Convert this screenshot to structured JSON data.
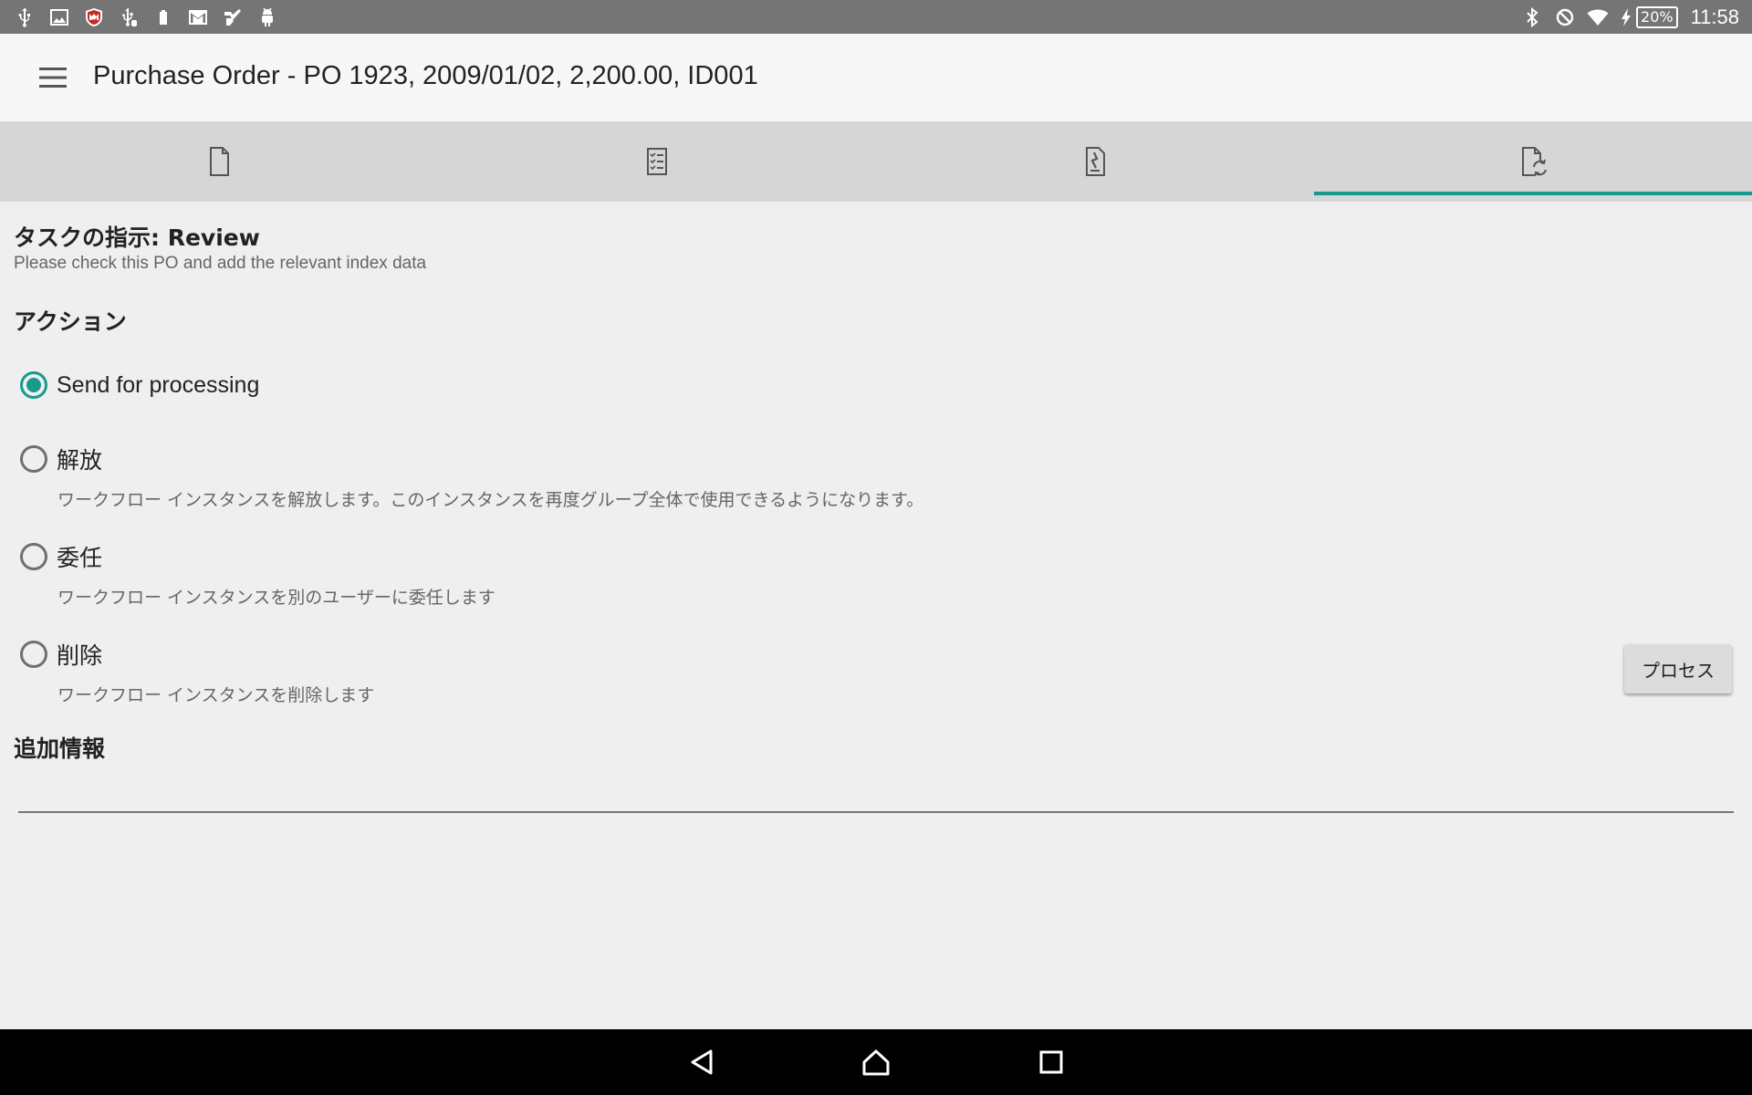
{
  "status_bar": {
    "left_icons": [
      "usb-icon",
      "image-icon",
      "mcafee-shield-icon",
      "usb-debug-icon",
      "battery-saver-icon",
      "gmail-icon",
      "play-store-icon",
      "android-debug-icon"
    ],
    "right_icons": [
      "bluetooth-icon",
      "do-not-disturb-icon",
      "wifi-icon",
      "charging-icon"
    ],
    "battery": "20%",
    "time": "11:58"
  },
  "app_bar": {
    "title": "Purchase Order - PO 1923, 2009/01/02, 2,200.00, ID001"
  },
  "tabs": [
    {
      "icon": "document-icon",
      "active": false
    },
    {
      "icon": "checklist-icon",
      "active": false
    },
    {
      "icon": "signature-document-icon",
      "active": false
    },
    {
      "icon": "workflow-document-icon",
      "active": true
    }
  ],
  "task": {
    "title": "タスクの指示: Review",
    "description": "Please check this PO and add the relevant index data"
  },
  "actions": {
    "heading": "アクション",
    "options": [
      {
        "label": "Send for processing",
        "description": "",
        "selected": true
      },
      {
        "label": "解放",
        "description": "ワークフロー インスタンスを解放します。このインスタンスを再度グループ全体で使用できるようになります。",
        "selected": false
      },
      {
        "label": "委任",
        "description": "ワークフロー インスタンスを別のユーザーに委任します",
        "selected": false
      },
      {
        "label": "削除",
        "description": "ワークフロー インスタンスを削除します",
        "selected": false
      }
    ],
    "process_button": "プロセス"
  },
  "extra_info": {
    "heading": "追加情報",
    "value": ""
  },
  "colors": {
    "accent": "#179a8c",
    "status_bar": "#757575",
    "tab_bar": "#d6d6d6",
    "background": "#efefef"
  },
  "nav_bar": {
    "icons": [
      "back-icon",
      "home-icon",
      "recents-icon"
    ]
  }
}
